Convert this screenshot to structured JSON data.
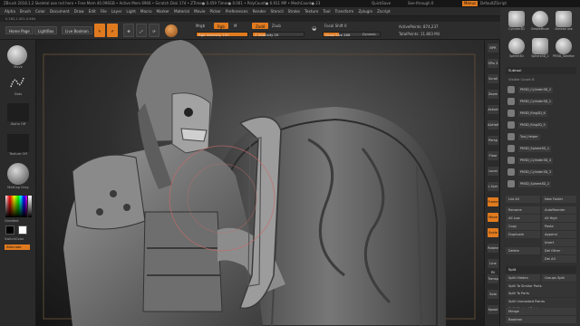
{
  "titlebar": {
    "title": "ZBrush 2018.1.2   Skeletal axe rnd hero   • Free Mem 40.096GB • Active Mem 6966 • Scratch Disk 174 • ZTime● 0.459 Timer● 0.001 • PolyCount● 6.911 MP • MeshCount● 23",
    "quicksave": "QuickSave",
    "see_through": "See-through  0",
    "menus_btn": "Menus",
    "default_script": "DefaultZScript"
  },
  "menubar": [
    "Alpha",
    "Brush",
    "Color",
    "Document",
    "Draw",
    "Edit",
    "File",
    "Layer",
    "Light",
    "Macro",
    "Marker",
    "Material",
    "Movie",
    "Picker",
    "Preferences",
    "Render",
    "Stencil",
    "Stroke",
    "Texture",
    "Tool",
    "Transform",
    "Zplugin",
    "Zscript"
  ],
  "infobar": "0.262,1.001,0.664",
  "toolbar": {
    "home_page": "Home Page",
    "lightbox": "LightBox",
    "live_boolean": "Live Boolean",
    "edit": "Edit",
    "draw": "Draw",
    "move": "Move",
    "scale": "Scale",
    "rotate": "Rotate",
    "mrgb": "Mrgb",
    "rgb": "Rgb",
    "m": "M",
    "rgb_intensity": "Rgb Intensity 100",
    "zadd": "Zadd",
    "zsub": "Zsub",
    "zintensity": "Z Intensity 25",
    "focal_shift": "Focal Shift 0",
    "draw_size": "Draw Size 286",
    "dynamic": "Dynamic",
    "active_points": "ActivePoints: 874,237",
    "total_points": "TotalPoints: 11.803 Mil",
    "rgb_intensity_pct": 100,
    "zintensity_pct": 25,
    "draw_size_pct": 28
  },
  "leftshelf": {
    "brush": "Move",
    "stroke": "Dots",
    "alpha": "Alpha Off",
    "texture": "Texture Off",
    "material": "MatCap Gray",
    "gradient": "Gradient",
    "switch_color": "SwitchColor",
    "alternate": "Alternate"
  },
  "rightshelf": [
    "BPR",
    "SPix 3",
    "Scroll",
    "Zoom",
    "Actual",
    "AAHalf",
    "Persp",
    "Floor",
    "Local",
    "L.Sym",
    "Frame",
    "Move",
    "Scale",
    "Rotate",
    "Line Fill",
    "Transp",
    "Solo",
    "Xpose"
  ],
  "tray": {
    "top_tools": [
      "Cylinder3D",
      "SimpleBrush",
      "Skeletal axe",
      "Sphere3D",
      "Sphere3D_1",
      "PM3D_Skeleton"
    ],
    "subtool_header": "Subtool",
    "visible_count": "Visible Count 8",
    "subtools": [
      "PM3D_Cylinder3D_2",
      "PM3D_Cylinder3D_1",
      "PM3D_Ring3D_6",
      "PM3D_Ring3D_5",
      "Tool_Helper",
      "PM3D_Sphere3D_1",
      "PM3D_Cylinder3D_4",
      "PM3D_Cylinder3D_3",
      "PM3D_Sphere3D_2"
    ],
    "list_all": "List All",
    "new_folder": "New Folder",
    "actions": [
      [
        "Rename",
        "AutoReorder"
      ],
      [
        "All Low",
        "All High"
      ],
      [
        "Copy",
        "Paste"
      ],
      [
        "Duplicate",
        "Append"
      ],
      [
        "",
        "Insert"
      ],
      [
        "Delete",
        "Del Other"
      ],
      [
        "",
        "Del All"
      ]
    ],
    "split_header": "Split",
    "split_items": [
      "Split Hidden",
      "Groups Split",
      "Split To Similar Parts",
      "Split To Parts",
      "Split Unmasked Points",
      "Split Masked Points"
    ],
    "merge": "Merge",
    "boolean": "Boolean",
    "remesh": "Remesh"
  }
}
